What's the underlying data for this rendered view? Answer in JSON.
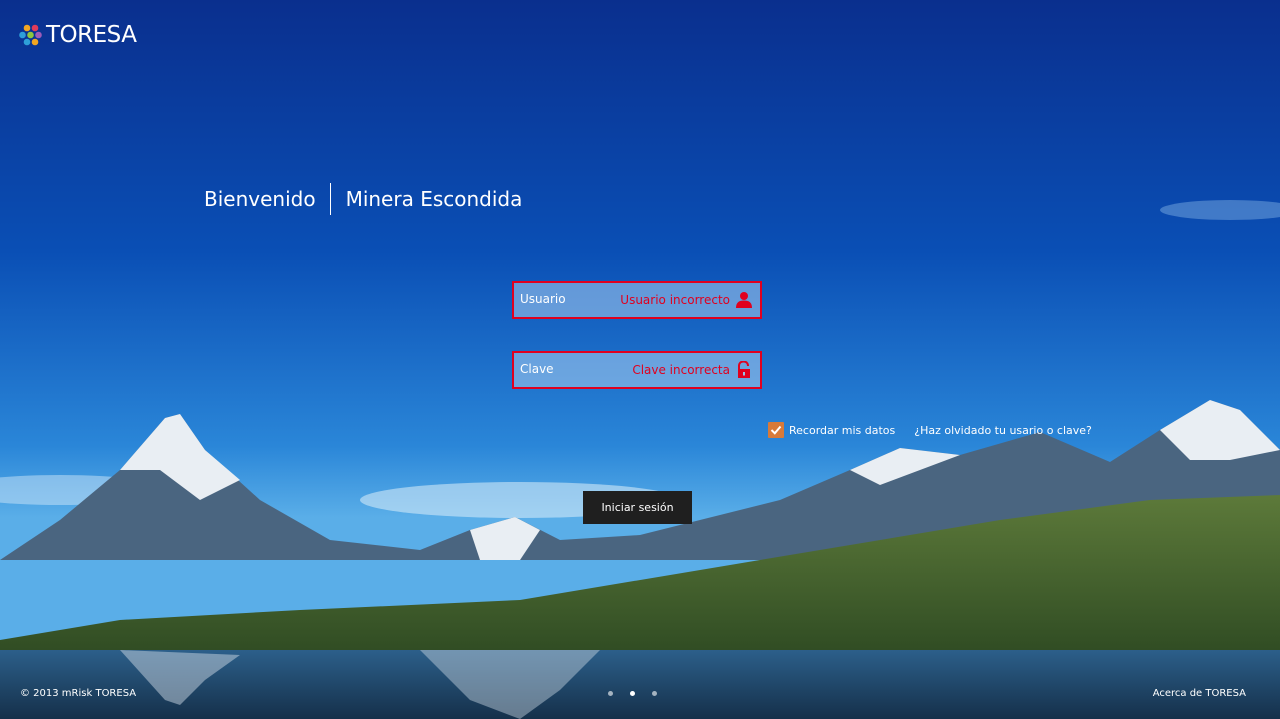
{
  "brand": {
    "name": "TORESA"
  },
  "welcome": {
    "greeting": "Bienvenido",
    "company": "Minera Escondida"
  },
  "form": {
    "username": {
      "label": "Usuario",
      "error": "Usuario incorrecto",
      "icon": "user-icon"
    },
    "password": {
      "label": "Clave",
      "error": "Clave incorrecta",
      "icon": "unlock-icon"
    },
    "remember_label": "Recordar mis datos",
    "remember_checked": true,
    "forgot_link": "¿Haz olvidado tu usario o clave?",
    "submit_label": "Iniciar sesión"
  },
  "footer": {
    "copyright": "© 2013 mRisk TORESA",
    "about_link": "Acerca de TORESA"
  },
  "carousel": {
    "total": 3,
    "active_index": 2
  },
  "colors": {
    "error": "#e0001f",
    "checkbox": "#d77a3a",
    "button": "#1f1f1f",
    "sky": "#0a4fb5"
  }
}
